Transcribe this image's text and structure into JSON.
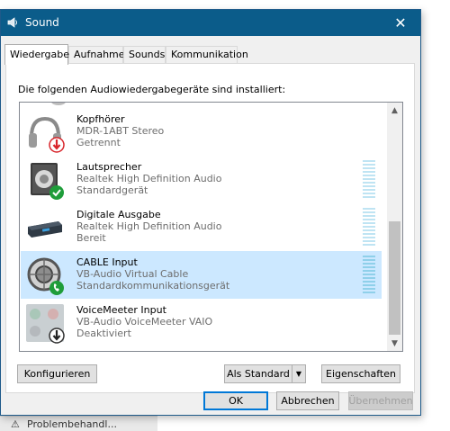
{
  "window": {
    "title": "Sound",
    "close_glyph": "✕"
  },
  "tabs": [
    "Wiedergabe",
    "Aufnahme",
    "Sounds",
    "Kommunikation"
  ],
  "description": "Die folgenden Audiowiedergabegeräte sind installiert:",
  "devices": [
    {
      "name": "Kopfhörer",
      "driver": "MDR-1ABT Stereo",
      "status": "Getrennt",
      "icon": "headphones-icon",
      "badge": "disconnected-badge-icon"
    },
    {
      "name": "Lautsprecher",
      "driver": "Realtek High Definition Audio",
      "status": "Standardgerät",
      "icon": "speaker-icon",
      "badge": "default-check-badge-icon"
    },
    {
      "name": "Digitale Ausgabe",
      "driver": "Realtek High Definition Audio",
      "status": "Bereit",
      "icon": "digital-output-icon",
      "badge": ""
    },
    {
      "name": "CABLE Input",
      "driver": "VB-Audio Virtual Cable",
      "status": "Standardkommunikationsgerät",
      "icon": "cable-icon",
      "badge": "default-communication-badge-icon"
    },
    {
      "name": "VoiceMeeter Input",
      "driver": "VB-Audio VoiceMeeter VAIO",
      "status": "Deaktiviert",
      "icon": "voicemeeter-icon",
      "badge": "disabled-badge-icon"
    }
  ],
  "buttons": {
    "configure": "Konfigurieren",
    "set_default": "Als Standard",
    "properties": "Eigenschaften",
    "ok": "OK",
    "cancel": "Abbrechen",
    "apply": "Übernehmen"
  },
  "background": {
    "taskbar_text": "Problembehandl..."
  },
  "colors": {
    "titlebar": "#0b5c8a",
    "selection": "#cce8ff",
    "badge_green": "#1f9d3a",
    "badge_red": "#d8252b"
  }
}
